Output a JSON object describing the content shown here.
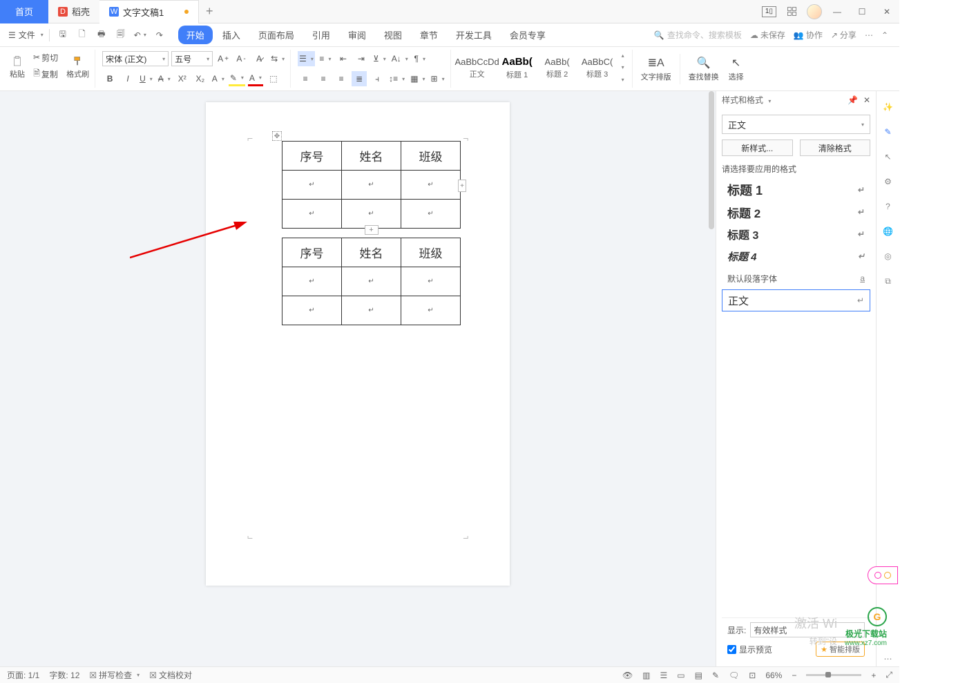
{
  "titlebar": {
    "home": "首页",
    "docer": "稻壳",
    "doc": "文字文稿1",
    "layout_badge": "1"
  },
  "menubar": {
    "file": "文件",
    "tabs": [
      "开始",
      "插入",
      "页面布局",
      "引用",
      "审阅",
      "视图",
      "章节",
      "开发工具",
      "会员专享"
    ],
    "search_placeholder": "查找命令、搜索模板",
    "unsaved": "未保存",
    "collab": "协作",
    "share": "分享"
  },
  "ribbon": {
    "paste": "粘贴",
    "cut": "剪切",
    "copy": "复制",
    "format_painter": "格式刷",
    "font_name": "宋体 (正文)",
    "font_size": "五号",
    "styles": [
      {
        "preview": "AaBbCcDd",
        "label": "正文"
      },
      {
        "preview": "AaBb(",
        "label": "标题 1"
      },
      {
        "preview": "AaBb(",
        "label": "标题 2"
      },
      {
        "preview": "AaBbC(",
        "label": "标题 3"
      }
    ],
    "layout": "文字排版",
    "findrep": "查找替换",
    "select": "选择"
  },
  "doc": {
    "table": {
      "headers": [
        "序号",
        "姓名",
        "班级"
      ],
      "rows": 2
    }
  },
  "panel": {
    "title": "样式和格式",
    "current": "正文",
    "new_style": "新样式...",
    "clear_fmt": "清除格式",
    "label": "请选择要应用的格式",
    "list": [
      "标题 1",
      "标题 2",
      "标题 3",
      "标题 4",
      "默认段落字体",
      "正文"
    ],
    "show_label": "显示:",
    "show_opt": "有效样式",
    "preview_chk": "显示预览",
    "smart": "智能排版"
  },
  "statusbar": {
    "page": "页面: 1/1",
    "words": "字数: 12",
    "spell": "拼写检查",
    "proof": "文档校对",
    "zoom": "66%"
  },
  "watermark": {
    "line1": "激活 Wi",
    "line2": "转到\"设",
    "brand_name": "极光下载站",
    "brand_url": "www.xz7.com"
  }
}
